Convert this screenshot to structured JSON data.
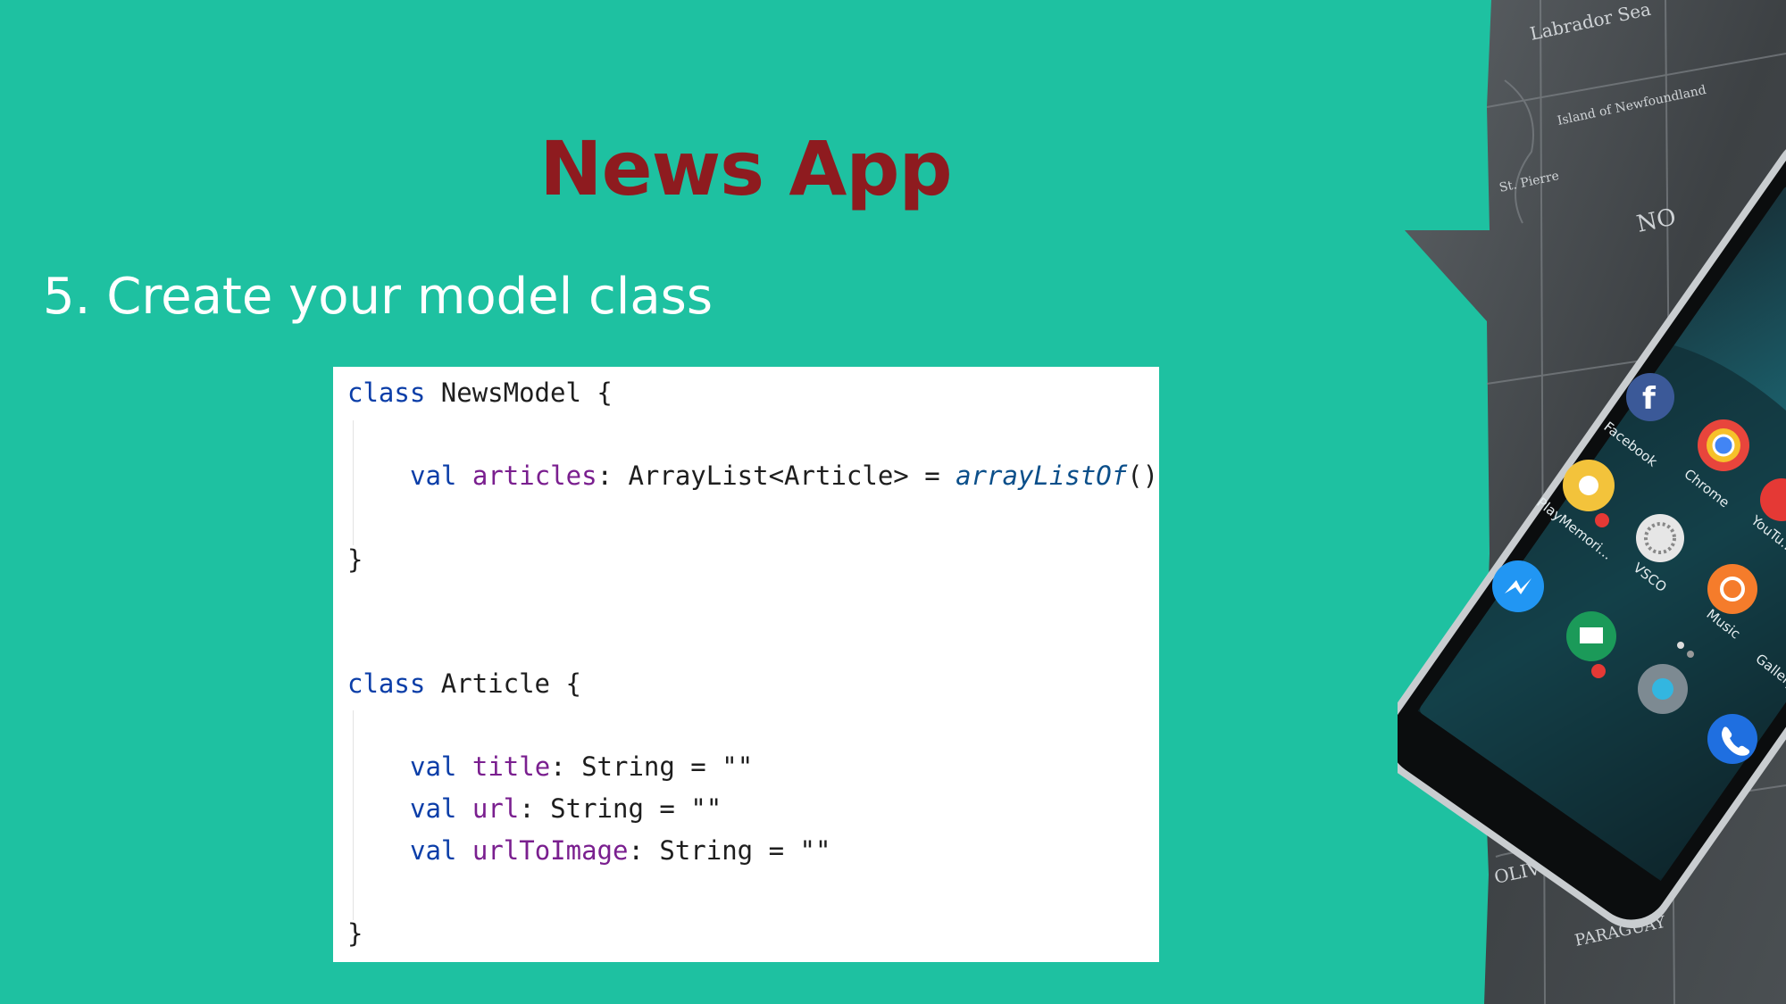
{
  "slide": {
    "title": "News App",
    "subtitle": "5. Create your model class"
  },
  "code": {
    "l1_kw": "class",
    "l1_rest": " NewsModel {",
    "l2_kw": "val",
    "l2_prop": "articles",
    "l2_type": ": ArrayList<Article> = ",
    "l2_fn": "arrayListOf",
    "l2_end": "()",
    "l3": "}",
    "l4_kw": "class",
    "l4_rest": " Article {",
    "l5_kw": "val",
    "l5_prop": "title",
    "l5_type": ": String = ",
    "l5_str": "\"\"",
    "l6_kw": "val",
    "l6_prop": "url",
    "l6_type": ": String = ",
    "l6_str": "\"\"",
    "l7_kw": "val",
    "l7_prop": "urlToImage",
    "l7_type": ": String = ",
    "l7_str": "\"\"",
    "l8": "}"
  },
  "photo": {
    "map_labels": [
      "Labrador Sea",
      "Island of Newfoundland",
      "St. Pierre",
      "NO",
      "OLIVIA",
      "PARAGUAY"
    ],
    "app_labels": [
      "Facebook",
      "Chrome",
      "PlayMemori...",
      "VSCO",
      "YouTu...",
      "Music",
      "Gallery"
    ]
  },
  "colors": {
    "background": "#1ec1a1",
    "title": "#8e1b1f",
    "keyword": "#0b3ea8",
    "property": "#7a1f8f"
  }
}
